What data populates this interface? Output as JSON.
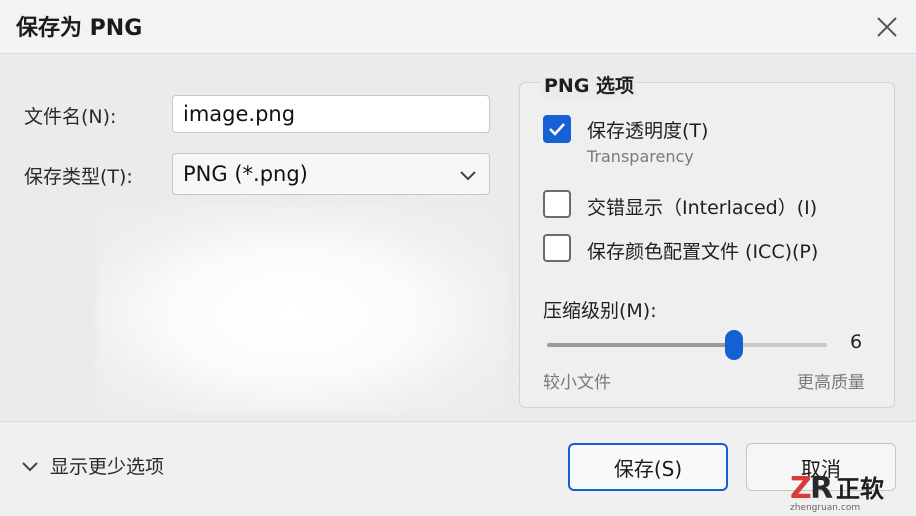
{
  "dialog": {
    "title": "保存为 PNG"
  },
  "form": {
    "filename_label": "文件名(N):",
    "filename_value": "image.png",
    "filetype_label": "保存类型(T):",
    "filetype_value": "PNG (*.png)"
  },
  "png_options": {
    "group_title": "PNG 选项",
    "transparency": {
      "label": "保存透明度(T)",
      "sublabel": "Transparency",
      "checked": true
    },
    "interlaced": {
      "label": "交错显示（Interlaced）(I)",
      "checked": false
    },
    "icc": {
      "label": "保存颜色配置文件 (ICC)(P)",
      "checked": false
    },
    "compression": {
      "label": "压缩级别(M):",
      "value": "6",
      "min": 0,
      "max": 9,
      "min_label": "较小文件",
      "max_label": "更高质量"
    }
  },
  "footer": {
    "toggle_label": "显示更少选项",
    "save_label": "保存(S)",
    "cancel_label": "取消"
  },
  "watermark": {
    "logo_text": "正软",
    "url": "zhengruan.com"
  },
  "colors": {
    "accent": "#1560d4",
    "watermark_red": "#d93a3a"
  }
}
